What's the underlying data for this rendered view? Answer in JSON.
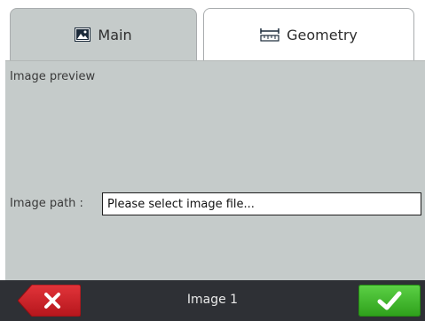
{
  "tabs": [
    {
      "label": "Main",
      "icon": "image-icon",
      "selected": true
    },
    {
      "label": "Geometry",
      "icon": "ruler-icon",
      "selected": false
    }
  ],
  "main": {
    "preview_label": "Image preview",
    "path_label": "Image path :",
    "path_input": {
      "value": "",
      "placeholder": "Please select image file..."
    }
  },
  "footer": {
    "title": "Image 1",
    "cancel_icon": "close-icon",
    "ok_icon": "check-icon"
  },
  "colors": {
    "panel_bg": "#c5cbca",
    "footer_bg": "#2e3035",
    "cancel_red": "#c81f25",
    "ok_green": "#3cb829"
  }
}
